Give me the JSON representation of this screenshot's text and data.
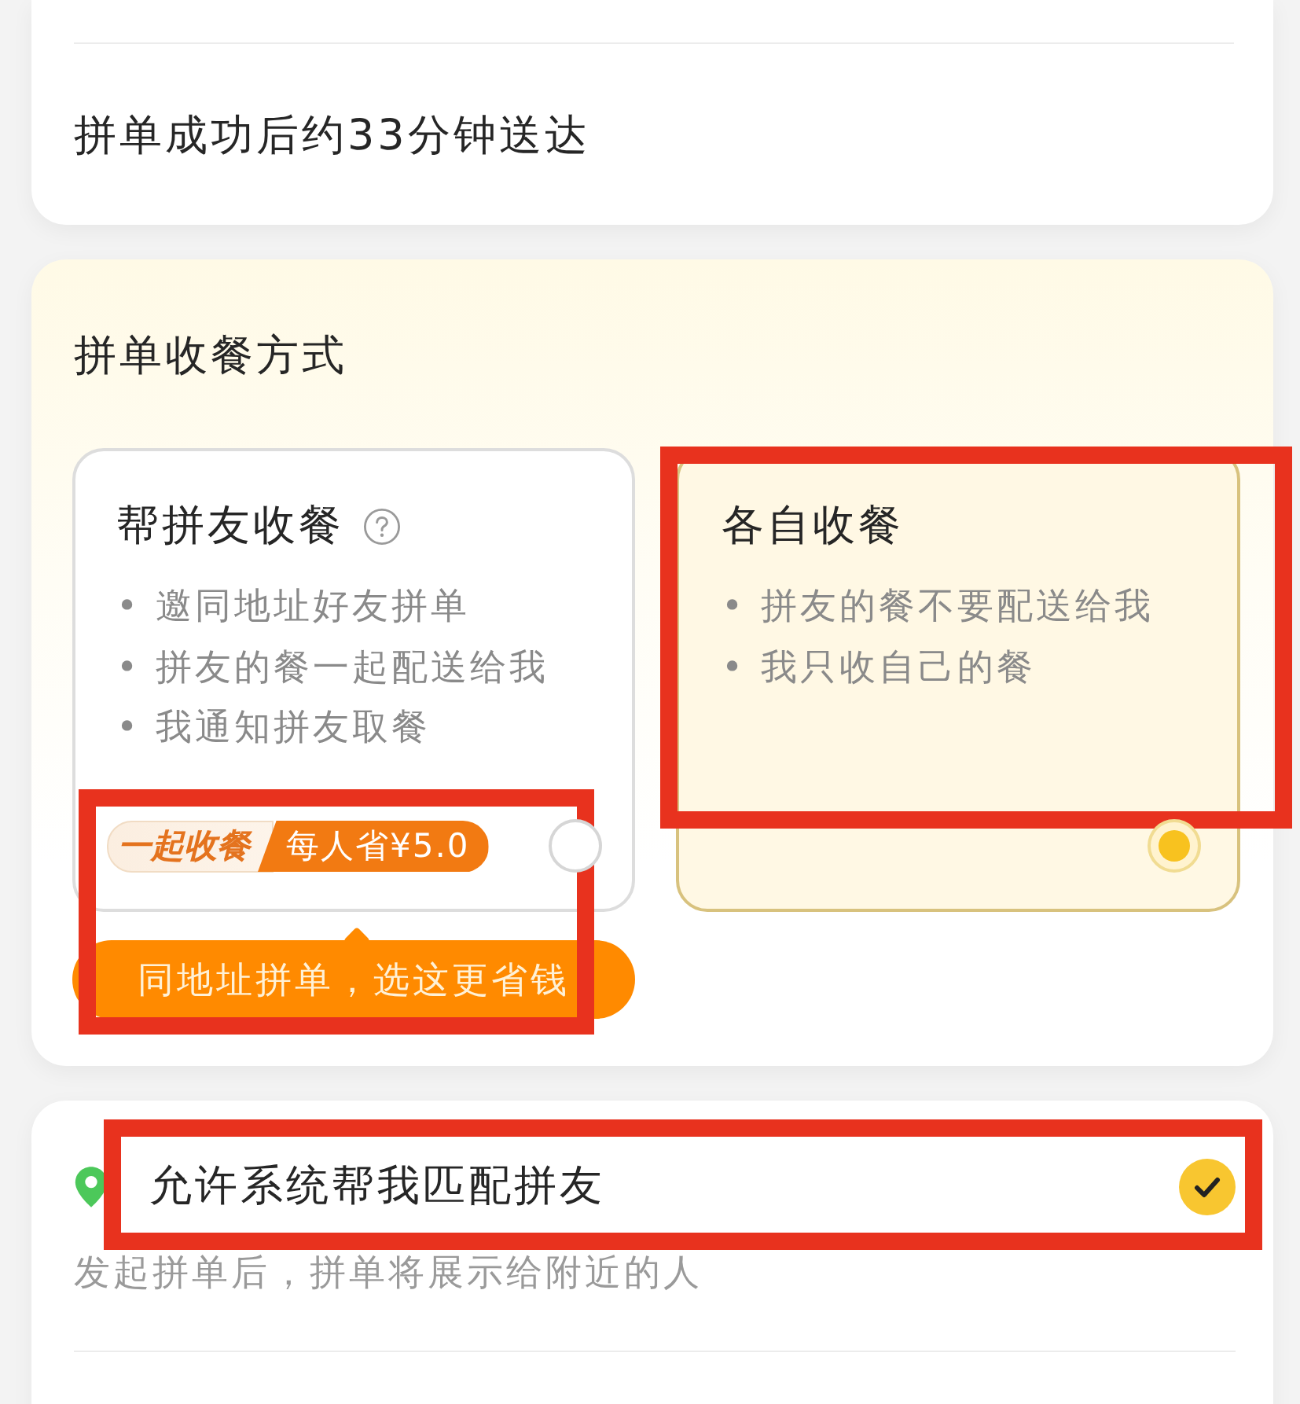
{
  "delivery_card": {
    "eta_text": "拼单成功后约33分钟送达"
  },
  "pickup_section": {
    "title": "拼单收餐方式",
    "options": [
      {
        "kind": "group",
        "title": "帮拼友收餐",
        "help": true,
        "bullets": [
          "• 邀同地址好友拼单",
          "• 拼友的餐一起配送给我",
          "• 我通知拼友取餐"
        ],
        "badge": {
          "tag": "一起收餐",
          "saving": "每人省¥5.0"
        },
        "selected": false
      },
      {
        "kind": "solo",
        "title": "各自收餐",
        "bullets": [
          "• 拼友的餐不要配送给我",
          "• 我只收自己的餐"
        ],
        "selected": true,
        "highlighted": true
      }
    ],
    "tip": {
      "text": "同地址拼单，选这更省钱",
      "highlighted": true
    }
  },
  "match_section": {
    "title": "允许系统帮我匹配拼友",
    "checked": true,
    "highlighted": true,
    "description": "发起拼单后，拼单将展示给附近的人"
  }
}
